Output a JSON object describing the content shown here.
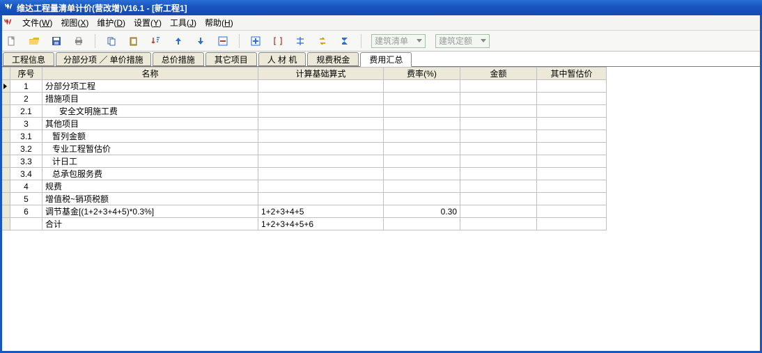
{
  "window": {
    "title": "维达工程量清单计价(营改增)V16.1 - [新工程1]"
  },
  "menu": {
    "items": [
      {
        "label": "文件",
        "key": "W"
      },
      {
        "label": "视图",
        "key": "X"
      },
      {
        "label": "维护",
        "key": "D"
      },
      {
        "label": "设置",
        "key": "Y"
      },
      {
        "label": "工具",
        "key": "J"
      },
      {
        "label": "帮助",
        "key": "H"
      }
    ]
  },
  "toolbar": {
    "combo1": "建筑清单",
    "combo2": "建筑定额"
  },
  "tabs": {
    "items": [
      "工程信息",
      "分部分项 ／ 单价措施",
      "总价措施",
      "其它项目",
      "人 材 机",
      "规费税金",
      "费用汇总"
    ],
    "active_index": 6
  },
  "grid": {
    "headers": [
      "序号",
      "名称",
      "计算基础算式",
      "费率(%)",
      "金额",
      "其中暂估价"
    ],
    "rows": [
      {
        "seq": "1",
        "name": "分部分项工程",
        "formula": "",
        "rate": "",
        "indent": 0
      },
      {
        "seq": "2",
        "name": "措施项目",
        "formula": "",
        "rate": "",
        "indent": 0
      },
      {
        "seq": "2.1",
        "name": "安全文明施工费",
        "formula": "",
        "rate": "",
        "indent": 2
      },
      {
        "seq": "3",
        "name": "其他项目",
        "formula": "",
        "rate": "",
        "indent": 0
      },
      {
        "seq": "3.1",
        "name": "暂列金额",
        "formula": "",
        "rate": "",
        "indent": 1
      },
      {
        "seq": "3.2",
        "name": "专业工程暂估价",
        "formula": "",
        "rate": "",
        "indent": 1
      },
      {
        "seq": "3.3",
        "name": "计日工",
        "formula": "",
        "rate": "",
        "indent": 1
      },
      {
        "seq": "3.4",
        "name": "总承包服务费",
        "formula": "",
        "rate": "",
        "indent": 1
      },
      {
        "seq": "4",
        "name": "规费",
        "formula": "",
        "rate": "",
        "indent": 0
      },
      {
        "seq": "5",
        "name": "增值税~销项税额",
        "formula": "",
        "rate": "",
        "indent": 0
      },
      {
        "seq": "6",
        "name": "调节基金[(1+2+3+4+5)*0.3%]",
        "formula": "1+2+3+4+5",
        "rate": "0.30",
        "indent": 0
      },
      {
        "seq": "",
        "name": "合计",
        "formula": "1+2+3+4+5+6",
        "rate": "",
        "indent": 0
      }
    ]
  }
}
